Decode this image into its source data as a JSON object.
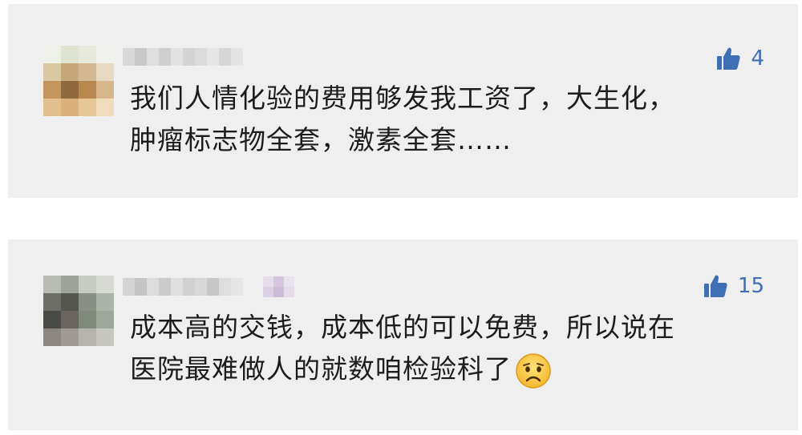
{
  "comments": [
    {
      "like_count": "4",
      "line1": "我们人情化验的费用够发我工资了，大生化，",
      "line2": "肿瘤标志物全套，激素全套……",
      "has_emoji": false
    },
    {
      "like_count": "15",
      "line1": "成本高的交钱，成本低的可以免费，所以说在",
      "line2": "医院最难做人的就数咱检验科了",
      "has_emoji": true,
      "emoji_icon": "sad-face-icon"
    }
  ],
  "colors": {
    "card_bg": "#efefef",
    "accent_blue": "#3f6fb5",
    "text": "#1c1c1c"
  },
  "icons": [
    "thumbs-up-icon",
    "sad-face-icon"
  ]
}
